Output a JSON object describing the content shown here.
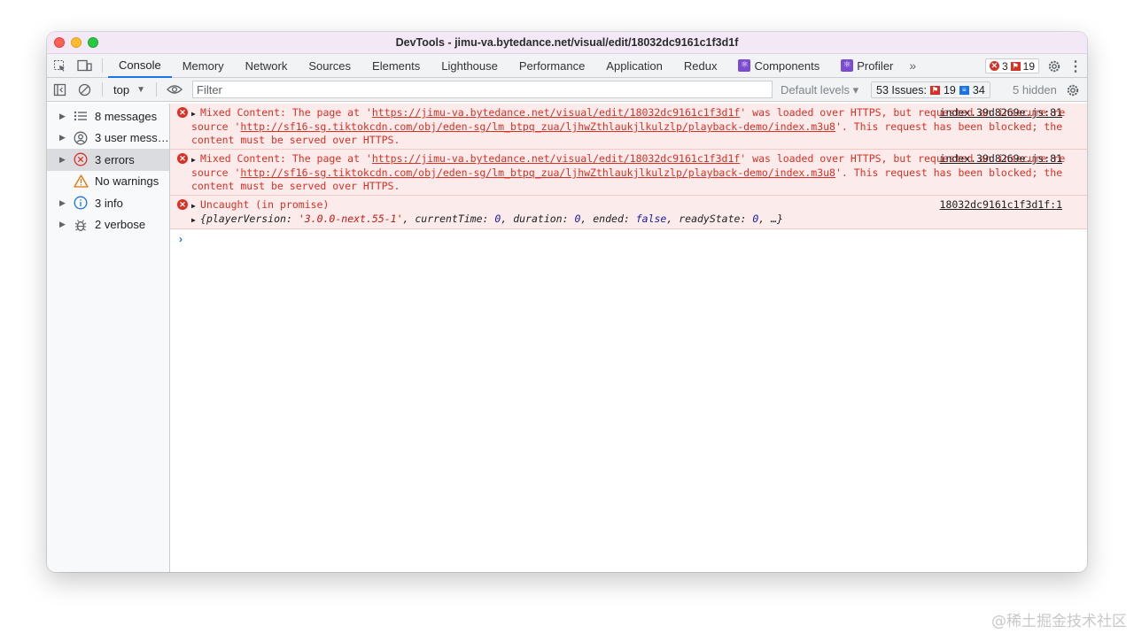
{
  "window": {
    "title": "DevTools - jimu-va.bytedance.net/visual/edit/18032dc9161c1f3d1f"
  },
  "tabs": [
    {
      "label": "Console",
      "active": true
    },
    {
      "label": "Memory"
    },
    {
      "label": "Network"
    },
    {
      "label": "Sources"
    },
    {
      "label": "Elements"
    },
    {
      "label": "Lighthouse"
    },
    {
      "label": "Performance"
    },
    {
      "label": "Application"
    },
    {
      "label": "Redux"
    },
    {
      "label": "Components",
      "icon": "react-icon"
    },
    {
      "label": "Profiler",
      "icon": "react-icon"
    }
  ],
  "counts": {
    "errors": "3",
    "warnings": "19"
  },
  "toolbar": {
    "context": "top",
    "filter_placeholder": "Filter",
    "levels": "Default levels",
    "issues_label": "53 Issues:",
    "issues_errors": "19",
    "issues_info": "34",
    "hidden": "5 hidden"
  },
  "sidebar": [
    {
      "label": "8 messages",
      "icon": "list-icon"
    },
    {
      "label": "3 user mess…",
      "icon": "user-icon"
    },
    {
      "label": "3 errors",
      "icon": "error-circle-icon",
      "selected": true
    },
    {
      "label": "No warnings",
      "icon": "warning-icon"
    },
    {
      "label": "3 info",
      "icon": "info-icon"
    },
    {
      "label": "2 verbose",
      "icon": "bug-icon"
    }
  ],
  "messages": [
    {
      "source": "index.39d8269e.js:81",
      "prefix": "Mixed Content: The page at '",
      "url1": "https://jimu-va.bytedance.net/visual/edit/18032dc9161c1f3d1f",
      "mid": "' was loaded over HTTPS, but requested an insecure resource '",
      "url2": "http://sf16-sg.tiktokcdn.com/obj/eden-sg/lm_btpq_zua/ljhwZthlaukjlkulzlp/playback-demo/index.m3u8",
      "suffix": "'. This request has been blocked; the content must be served over HTTPS."
    },
    {
      "source": "index.39d8269e.js:81",
      "prefix": "Mixed Content: The page at '",
      "url1": "https://jimu-va.bytedance.net/visual/edit/18032dc9161c1f3d1f",
      "mid": "' was loaded over HTTPS, but requested an insecure resource '",
      "url2": "http://sf16-sg.tiktokcdn.com/obj/eden-sg/lm_btpq_zua/ljhwZthlaukjlkulzlp/playback-demo/index.m3u8",
      "suffix": "'. This request has been blocked; the content must be served over HTTPS."
    },
    {
      "source": "18032dc9161c1f3d1f:1",
      "text": "Uncaught (in promise)",
      "object": {
        "k1": "playerVersion",
        "v1": "'3.0.0-next.55-1'",
        "k2": "currentTime",
        "v2": "0",
        "k3": "duration",
        "v3": "0",
        "k4": "ended",
        "v4": "false",
        "k5": "readyState",
        "v5": "0"
      }
    }
  ],
  "watermark": "@稀土掘金技术社区"
}
